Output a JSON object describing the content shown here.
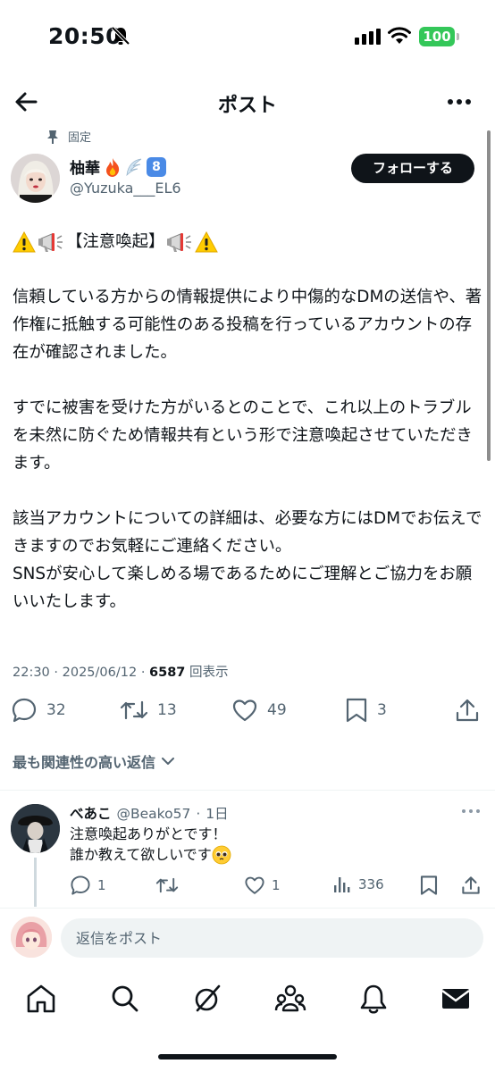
{
  "status_bar": {
    "time": "20:50",
    "battery": "100"
  },
  "header": {
    "title": "ポスト"
  },
  "pinned": {
    "label": "固定"
  },
  "author": {
    "name": "柚華",
    "badge": "8",
    "handle": "@Yuzuka___EL6",
    "follow_label": "フォローする"
  },
  "post": {
    "heading": "【注意喚起】",
    "paragraph_1": "信頼している方からの情報提供により中傷的なDMの送信や、著作権に抵触する可能性のある投稿を行っているアカウントの存在が確認されました。",
    "paragraph_2": "すでに被害を受けた方がいるとのことで、これ以上のトラブルを未然に防ぐため情報共有という形で注意喚起させていただきます。",
    "paragraph_3": "該当アカウントについての詳細は、必要な方にはDMでお伝えできますのでお気軽にご連絡ください。",
    "paragraph_4": "SNSが安心して楽しめる場であるためにご理解とご協力をお願いいたします。"
  },
  "meta": {
    "time": "22:30",
    "date": "2025/06/12",
    "separator": "·",
    "views": "6587",
    "views_label": "回表示"
  },
  "actions": {
    "replies": "32",
    "reposts": "13",
    "likes": "49",
    "bookmarks": "3"
  },
  "replies_sort": {
    "label": "最も関連性の高い返信"
  },
  "reply": {
    "name": "べあこ",
    "handle": "@Beako57",
    "dot": "·",
    "time": "1日",
    "line_1": "注意喚起ありがとです！",
    "line_2": "誰か教えて欲しいです",
    "replies": "1",
    "likes": "1",
    "views": "336"
  },
  "compose": {
    "placeholder": "返信をポスト"
  },
  "colors": {
    "accent": "#0f1419",
    "muted": "#536471",
    "battery": "#34c759",
    "badge": "#4a8ae6"
  },
  "icons": [
    "back-arrow-icon",
    "more-icon",
    "pin-icon",
    "reply-icon",
    "repost-icon",
    "like-icon",
    "bookmark-icon",
    "share-icon",
    "views-icon",
    "home-icon",
    "search-icon",
    "grok-icon",
    "communities-icon",
    "notifications-icon",
    "messages-icon"
  ]
}
